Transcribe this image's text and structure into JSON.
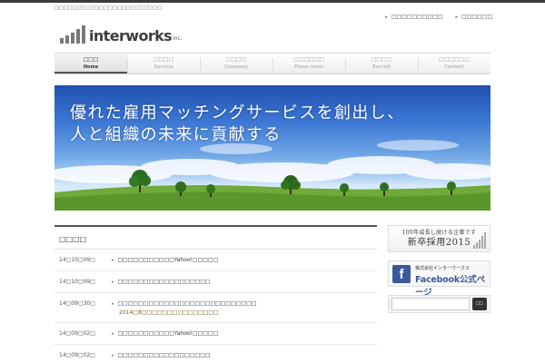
{
  "header": {
    "tagline": "□□□□□□□□□□□□□□□□□□□□□□□□",
    "toplinks": [
      "□□□□□□□□□□",
      "□□□□□□"
    ],
    "logo_text": "interworks",
    "logo_suffix": "inc."
  },
  "nav": [
    {
      "jp": "□□□",
      "en": "Home",
      "active": true
    },
    {
      "jp": "□□□□",
      "en": "Service",
      "active": false
    },
    {
      "jp": "□□□□",
      "en": "Company",
      "active": false
    },
    {
      "jp": "□□□□□□",
      "en": "Press room",
      "active": false
    },
    {
      "jp": "□□□□",
      "en": "Recruit",
      "active": false
    },
    {
      "jp": "□□□□□□",
      "en": "Contact",
      "active": false
    }
  ],
  "hero": {
    "line1": "優れた雇用マッチングサービスを創出し、",
    "line2": "人と組織の未来に貢献する"
  },
  "news": {
    "title": "□□□□",
    "items": [
      {
        "date": "14□10□09□",
        "text": "□□□□□□□□□□□Yahoo!□□□□□",
        "sub": ""
      },
      {
        "date": "14□10□09□",
        "text": "□□□□□□□□□□□□□□□□□□",
        "sub": ""
      },
      {
        "date": "14□09□30□",
        "text": "□□□□□□□□□□□□□□□□□□□□□□□□□□□",
        "sub": "2014□8□□□□□□□□□□□□□□□"
      },
      {
        "date": "14□09□02□",
        "text": "□□□□□□□□□□□Yahoo!□□□□□",
        "sub": ""
      },
      {
        "date": "14□09□02□",
        "text": "□□□□□□□□□□□□□□□□□□",
        "sub": ""
      }
    ]
  },
  "sidebar": {
    "recruit_small": "100年成長し続ける企業です",
    "recruit_big": "新卒採用2015",
    "facebook_small": "株式会社インターワークス",
    "facebook_big": "Facebook公式ページ",
    "facebook_icon": "f",
    "search_placeholder": "",
    "search_button": "□□"
  },
  "colors": {
    "nav_active_border": "#555555",
    "facebook_blue": "#3b5998",
    "search_button": "#333333"
  }
}
